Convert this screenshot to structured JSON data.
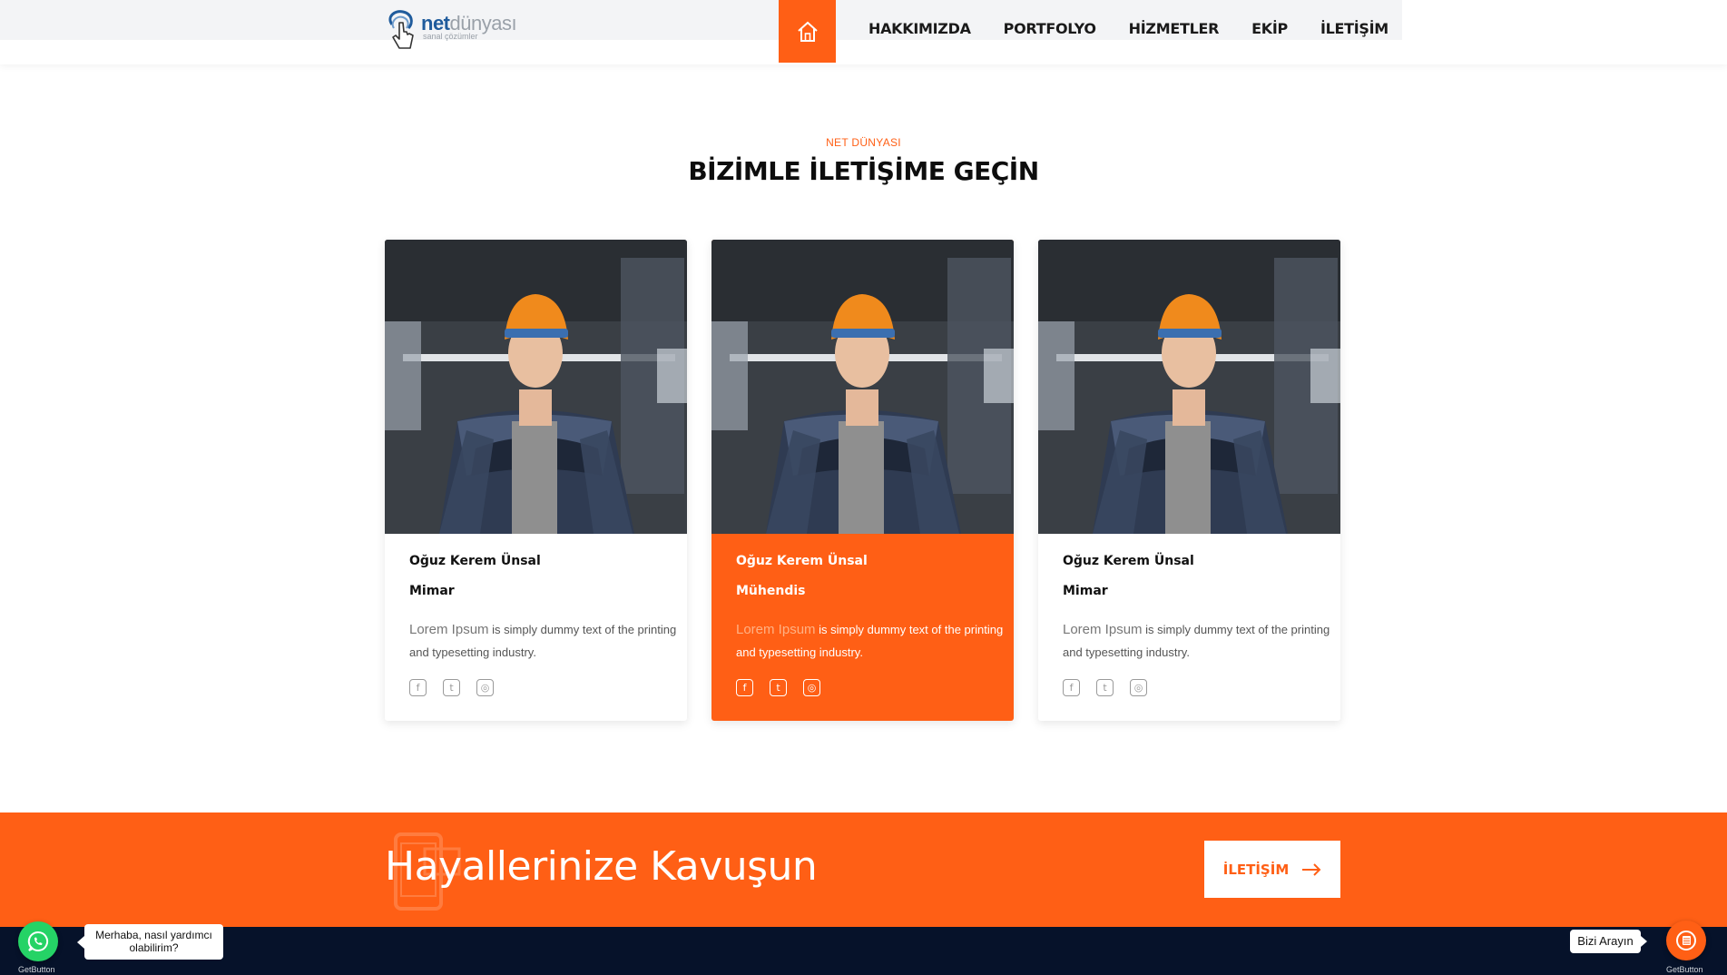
{
  "header": {
    "logo": {
      "primary": "net",
      "secondary": "dünyası",
      "tagline": "sanal çözümler"
    },
    "home_icon": "home-icon",
    "nav": [
      "HAKKIMIZDA",
      "PORTFOLYO",
      "HİZMETLER",
      "EKİP",
      "İLETİŞİM"
    ]
  },
  "section": {
    "eyebrow": "NET DÜNYASI",
    "title": "BİZİMLE İLETİŞİME GEÇİN"
  },
  "team": [
    {
      "name": "Oğuz Kerem Ünsal",
      "role": "Mimar",
      "desc_highlight": "Lorem Ipsum",
      "desc_rest": " is simply dummy text of the printing and typesetting industry.",
      "active": false
    },
    {
      "name": "Oğuz Kerem Ünsal",
      "role": "Mühendis",
      "desc_highlight": "Lorem Ipsum",
      "desc_rest": " is simply dummy text of the printing and typesetting industry.",
      "active": true
    },
    {
      "name": "Oğuz Kerem Ünsal",
      "role": "Mimar",
      "desc_highlight": "Lorem Ipsum",
      "desc_rest": " is simply dummy text of the printing and typesetting industry.",
      "active": false
    }
  ],
  "social_icons": [
    "facebook-icon",
    "twitter-icon",
    "instagram-icon"
  ],
  "cta": {
    "title": "Hayallerinize Kavuşun",
    "button_label": "İLETİŞİM",
    "button_icon": "arrow-right-icon"
  },
  "widgets": {
    "whatsapp_greeting": "Merhaba, nasıl yardımcı olabilirim?",
    "whatsapp_brand": "GetButton",
    "call_label": "Bizi Arayın",
    "call_brand": "GetButton"
  },
  "colors": {
    "accent": "#ff5f15",
    "footer": "#06122a",
    "whatsapp": "#25d366"
  }
}
